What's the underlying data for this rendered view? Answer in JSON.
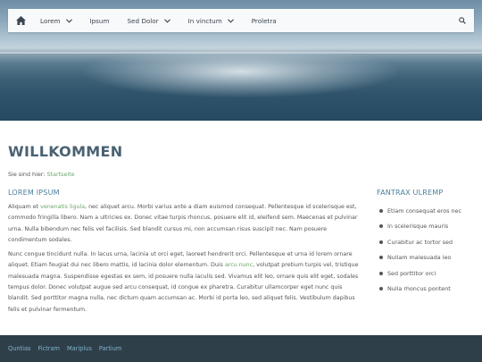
{
  "nav": {
    "items": [
      {
        "label": "Lorem",
        "has_dropdown": true
      },
      {
        "label": "Ipsum",
        "has_dropdown": false
      },
      {
        "label": "Sed Dolor",
        "has_dropdown": true
      },
      {
        "label": "In vinctum",
        "has_dropdown": true
      },
      {
        "label": "Proletra",
        "has_dropdown": false
      }
    ],
    "home_icon": "home-icon",
    "search_icon": "search-icon"
  },
  "page": {
    "title": "WILLKOMMEN",
    "breadcrumb_prefix": "Sie sind hier:",
    "breadcrumb_link": "Startseite"
  },
  "main": {
    "heading": "LOREM IPSUM",
    "p1_a": "Aliquam et ",
    "p1_link": "venenatis ligula",
    "p1_b": ", nec aliquet arcu. Morbi varius ante a diam euismod consequat. Pellentesque id scelerisque est, commodo fringilla libero. Nam a ultricies ex. Donec vitae turpis rhoncus, posuere elit id, eleifend sem. Maecenas et pulvinar urna. Nulla bibendum nec felis vel facilisis. Sed blandit cursus mi, non accumsan risus suscipit nec. Nam posuere condimentum sodales.",
    "p2_a": "Nunc congue tincidunt nulla. In lacus urna, lacinia ut orci eget, laoreet hendrerit orci. Pellentesque et urna id lorem ornare aliquet. Etiam feugiat dui nec libero mattis, id lacinia dolor elementum. Duis ",
    "p2_link": "arcu nunc",
    "p2_b": ", volutpat pretium turpis vel, tristique malesuada magna. Suspendisse egestas ex sem, id posuere nulla iaculis sed. Vivamus elit leo, ornare quis elit eget, sodales tempus dolor. Donec volutpat augue sed arcu consequat, id congue ex pharetra. Curabitur ullamcorper eget nunc quis blandit. Sed porttitor magna nulla, nec dictum quam accumsan ac. Morbi id porta leo, sed aliquet felis. Vestibulum dapibus felis et pulvinar fermentum."
  },
  "sidebar": {
    "heading": "FANTRAX ULREMP",
    "items": [
      "Etiam consequat eros nec",
      "In scelerisque mauris",
      "Curabitur ac tortor sed",
      "Nullam malesuada leo",
      "Sed porttitor orci",
      "Nulla rhoncus pontent"
    ]
  },
  "footer": {
    "links": [
      "Quntias",
      "Fictram",
      "Mariplus",
      "Partium"
    ]
  },
  "colors": {
    "link_green": "#6aa86a",
    "heading_blue": "#4a7f9a",
    "footer_bg": "#2f3f4a",
    "footer_link": "#7fb3c9"
  }
}
